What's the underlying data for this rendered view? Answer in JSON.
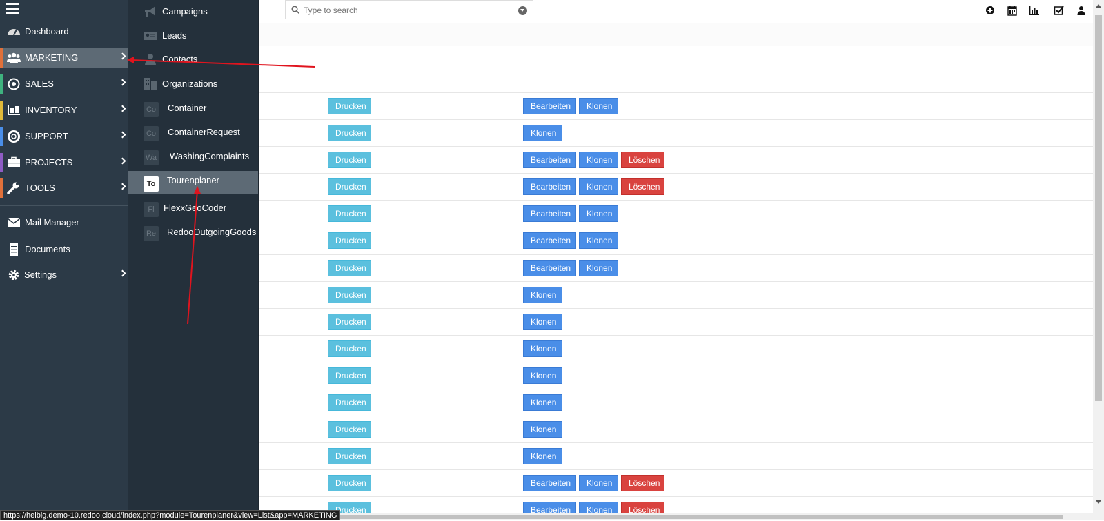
{
  "search": {
    "placeholder": "Type to search"
  },
  "toolbar": {
    "icons": [
      "plus-circle-icon",
      "calendar-icon",
      "bar-chart-icon",
      "checkbox-icon",
      "user-icon"
    ]
  },
  "sidebar": {
    "items": [
      {
        "label": "Dashboard",
        "icon": "dashboard-icon"
      },
      {
        "label": "MARKETING",
        "icon": "users-icon",
        "color": "#e0703a"
      },
      {
        "label": "SALES",
        "icon": "target-icon",
        "color": "#3fb27f"
      },
      {
        "label": "INVENTORY",
        "icon": "inventory-icon",
        "color": "#e0b93a"
      },
      {
        "label": "SUPPORT",
        "icon": "lifebuoy-icon",
        "color": "#4a8ee8"
      },
      {
        "label": "PROJECTS",
        "icon": "briefcase-icon",
        "color": "#8e5cc4"
      },
      {
        "label": "TOOLS",
        "icon": "wrench-icon",
        "color": "#e0703a"
      },
      {
        "label": "Mail Manager",
        "icon": "mail-icon"
      },
      {
        "label": "Documents",
        "icon": "documents-icon"
      },
      {
        "label": "Settings",
        "icon": "gear-icon"
      }
    ]
  },
  "submenu": {
    "items": [
      {
        "label": "Campaigns",
        "icon": "megaphone-icon"
      },
      {
        "label": "Leads",
        "icon": "id-card-icon"
      },
      {
        "label": "Contacts",
        "icon": "person-icon"
      },
      {
        "label": "Organizations",
        "icon": "building-icon"
      },
      {
        "label": "Container",
        "badge": "Co"
      },
      {
        "label": "ContainerRequest",
        "badge": "Co"
      },
      {
        "label": "WashingComplaints",
        "badge": "Wa"
      },
      {
        "label": "Tourenplaner",
        "badge": "To"
      },
      {
        "label": "FlexxGeoCoder",
        "badge": "Fl"
      },
      {
        "label": "RedooOutgoingGoods",
        "badge": "Re"
      }
    ]
  },
  "buttons": {
    "print": "Drucken",
    "edit": "Bearbeiten",
    "clone": "Klonen",
    "delete": "Löschen"
  },
  "rows": [
    [
      "edit",
      "clone"
    ],
    [
      "clone"
    ],
    [
      "edit",
      "clone",
      "delete"
    ],
    [
      "edit",
      "clone",
      "delete"
    ],
    [
      "edit",
      "clone"
    ],
    [
      "edit",
      "clone"
    ],
    [
      "edit",
      "clone"
    ],
    [
      "clone"
    ],
    [
      "clone"
    ],
    [
      "clone"
    ],
    [
      "clone"
    ],
    [
      "clone"
    ],
    [
      "clone"
    ],
    [
      "clone"
    ],
    [
      "edit",
      "clone",
      "delete"
    ],
    [
      "edit",
      "clone",
      "delete"
    ]
  ],
  "status_url": "https://helbig.demo-10.redoo.cloud/index.php?module=Tourenplaner&view=List&app=MARKETING"
}
